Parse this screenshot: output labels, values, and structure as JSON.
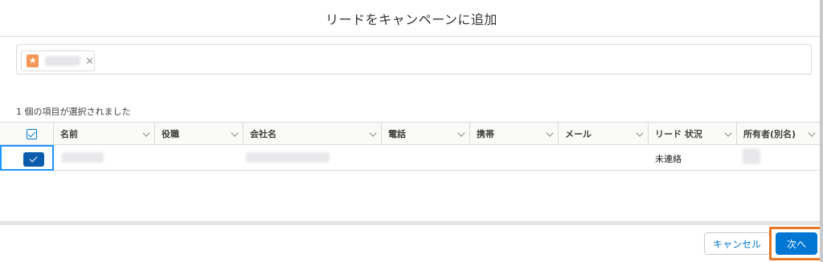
{
  "modal": {
    "title": "リードをキャンペーンに追加"
  },
  "selection": {
    "pill_icon": "campaign-icon",
    "pill_close": "×",
    "count_text": "1 個の項目が選択されました"
  },
  "table": {
    "columns": [
      "名前",
      "役職",
      "会社名",
      "電話",
      "携帯",
      "メール",
      "リード 状況",
      "所有者(別名)"
    ],
    "rows": [
      {
        "status": "未連絡"
      }
    ]
  },
  "footer": {
    "cancel_label": "キャンセル",
    "next_label": "次へ"
  },
  "colors": {
    "brand": "#0176d3",
    "highlight": "#e87722",
    "campaign_icon": "#f49756"
  }
}
